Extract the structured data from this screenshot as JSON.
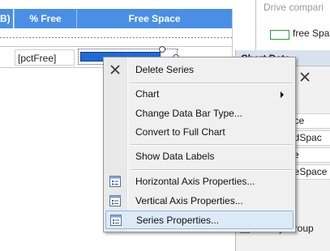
{
  "table": {
    "prev_header": "B)",
    "pct_header": "% Free",
    "free_header": "Free Space",
    "pct_cell": "[pctFree]",
    "bar_fill": 0.85
  },
  "chart": {
    "title": "Drive compari",
    "legend_label": "free Spa",
    "legend_color": "#2d9a3a"
  },
  "panel": {
    "title": "Chart Data",
    "fields": [
      "ace",
      "edSpac",
      "ce",
      "eeSpace"
    ],
    "category_label": "y Group"
  },
  "context_menu": {
    "items": [
      {
        "label": "Delete Series",
        "icon": "delete-x-icon"
      },
      {
        "label": "Chart",
        "icon": null,
        "submenu": true
      },
      {
        "label": "Change Data Bar Type...",
        "icon": null
      },
      {
        "label": "Convert to Full Chart",
        "icon": null
      },
      {
        "label": "Show Data Labels",
        "icon": null
      },
      {
        "label": "Horizontal Axis Properties...",
        "icon": "properties-icon"
      },
      {
        "label": "Vertical Axis Properties...",
        "icon": "properties-icon"
      },
      {
        "label": "Series Properties...",
        "icon": "properties-icon",
        "highlighted": true
      }
    ]
  },
  "colors": {
    "header_blue": "#4a8fe6",
    "bar_blue": "#1e6bd6",
    "menu_highlight": "#dceaf7"
  }
}
